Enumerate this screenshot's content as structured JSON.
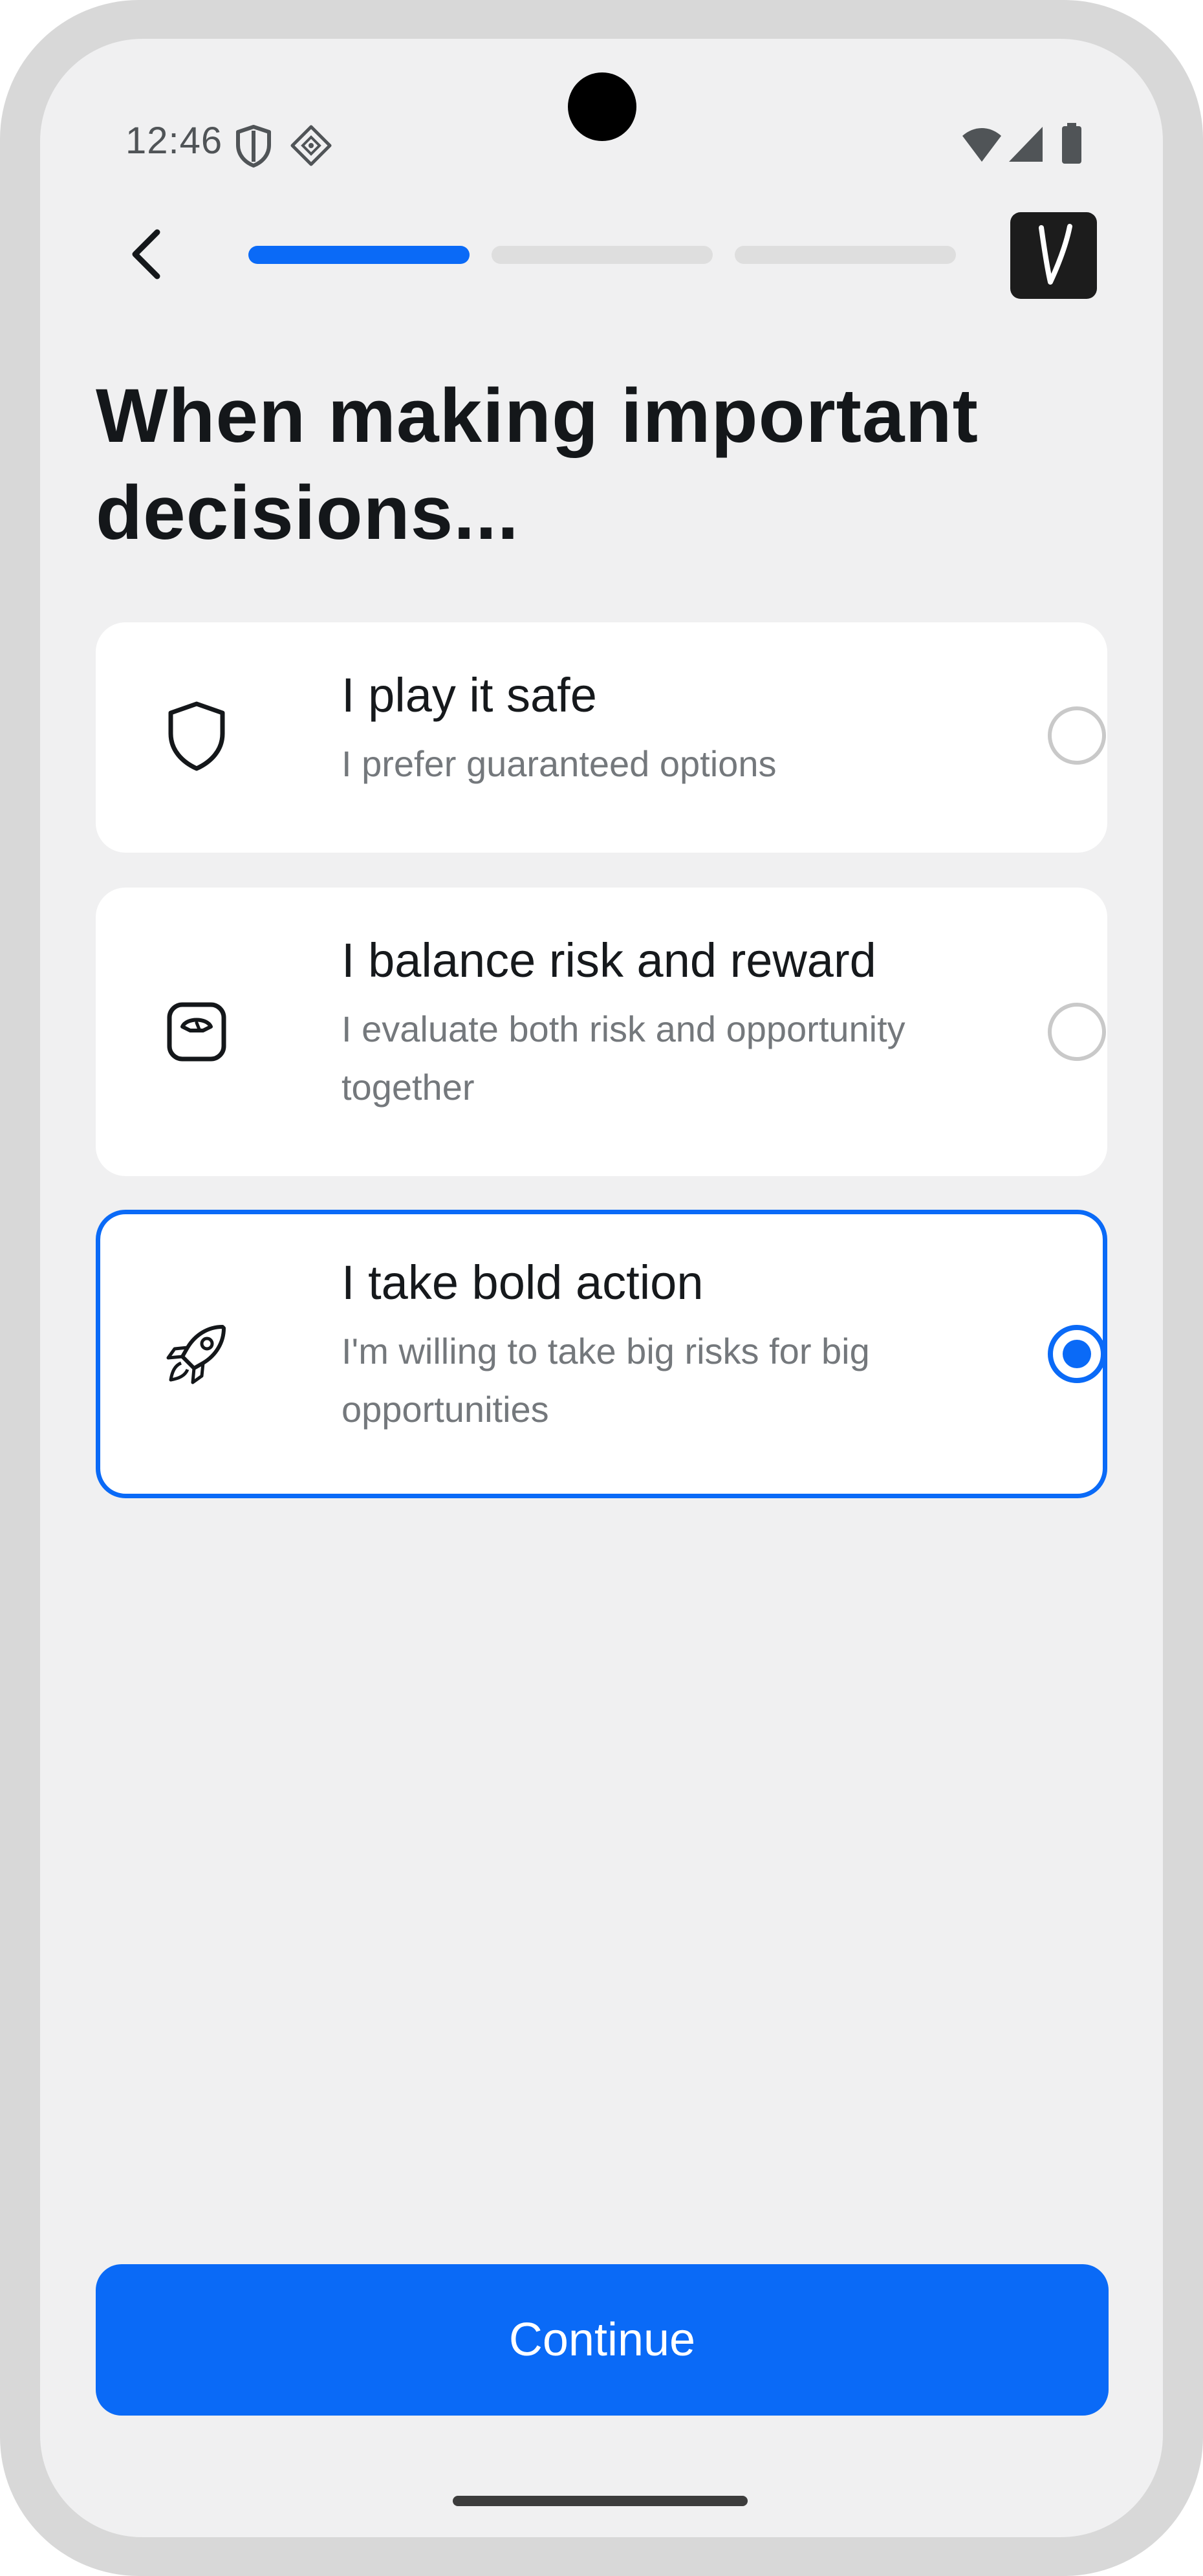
{
  "status_bar": {
    "time": "12:46",
    "icons": [
      "shield-icon",
      "diamond-grid-icon",
      "wifi-icon",
      "signal-icon",
      "battery-icon"
    ]
  },
  "header": {
    "back_icon": "chevron-left-icon",
    "progress_steps": [
      {
        "state": "active",
        "color": "#0a6af7"
      },
      {
        "state": "inactive",
        "color": "#dedede"
      },
      {
        "state": "inactive",
        "color": "#dedede"
      }
    ],
    "logo_letter": "V"
  },
  "question": {
    "title": "When making important decisions..."
  },
  "options": [
    {
      "icon": "shield-icon",
      "title": "I play it safe",
      "description": "I prefer guaranteed options",
      "selected": false
    },
    {
      "icon": "scale-icon",
      "title": "I balance risk and reward",
      "description": "I evaluate both risk and opportunity together",
      "selected": false
    },
    {
      "icon": "rocket-icon",
      "title": "I take bold action",
      "description": "I'm willing to take big risks for big opportunities",
      "selected": true
    }
  ],
  "footer": {
    "continue_label": "Continue"
  },
  "colors": {
    "accent": "#0a6af7",
    "background": "#f0f0f1",
    "card": "#ffffff",
    "text_primary": "#14171a",
    "text_secondary": "#74787c"
  }
}
